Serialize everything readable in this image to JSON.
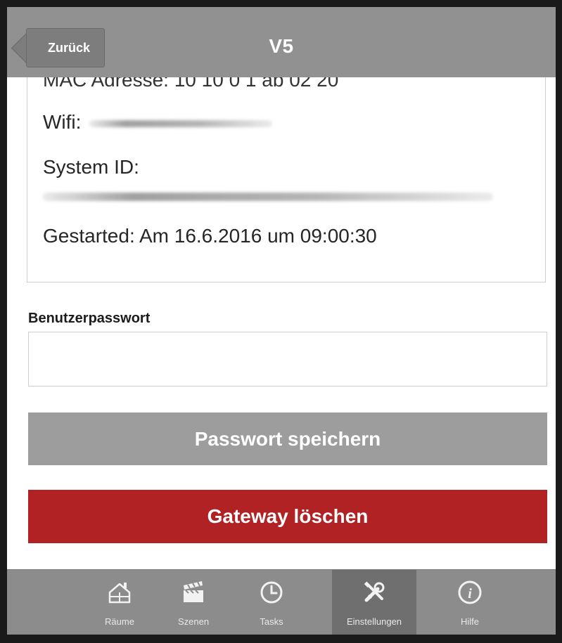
{
  "header": {
    "back_label": "Zurück",
    "title": "V5"
  },
  "info": {
    "mac_partial": "MAC Adresse: 10 10 0 1 ab 02 20",
    "wifi_label": "Wifi:",
    "system_id_label": "System ID:",
    "started": "Gestarted: Am 16.6.2016 um 09:00:30"
  },
  "password": {
    "label": "Benutzerpasswort",
    "value": "",
    "placeholder": ""
  },
  "buttons": {
    "save": "Passwort speichern",
    "delete": "Gateway löschen"
  },
  "nav": {
    "items": [
      {
        "label": "Räume",
        "icon": "house-icon"
      },
      {
        "label": "Szenen",
        "icon": "clapperboard-icon"
      },
      {
        "label": "Tasks",
        "icon": "clock-icon"
      },
      {
        "label": "Einstellungen",
        "icon": "tools-icon"
      },
      {
        "label": "Hilfe",
        "icon": "info-icon"
      }
    ],
    "active": "Einstellungen"
  },
  "colors": {
    "header": "#919191",
    "save_button": "#9d9d9d",
    "delete_button": "#b12225",
    "nav": "#8c8c8c"
  }
}
